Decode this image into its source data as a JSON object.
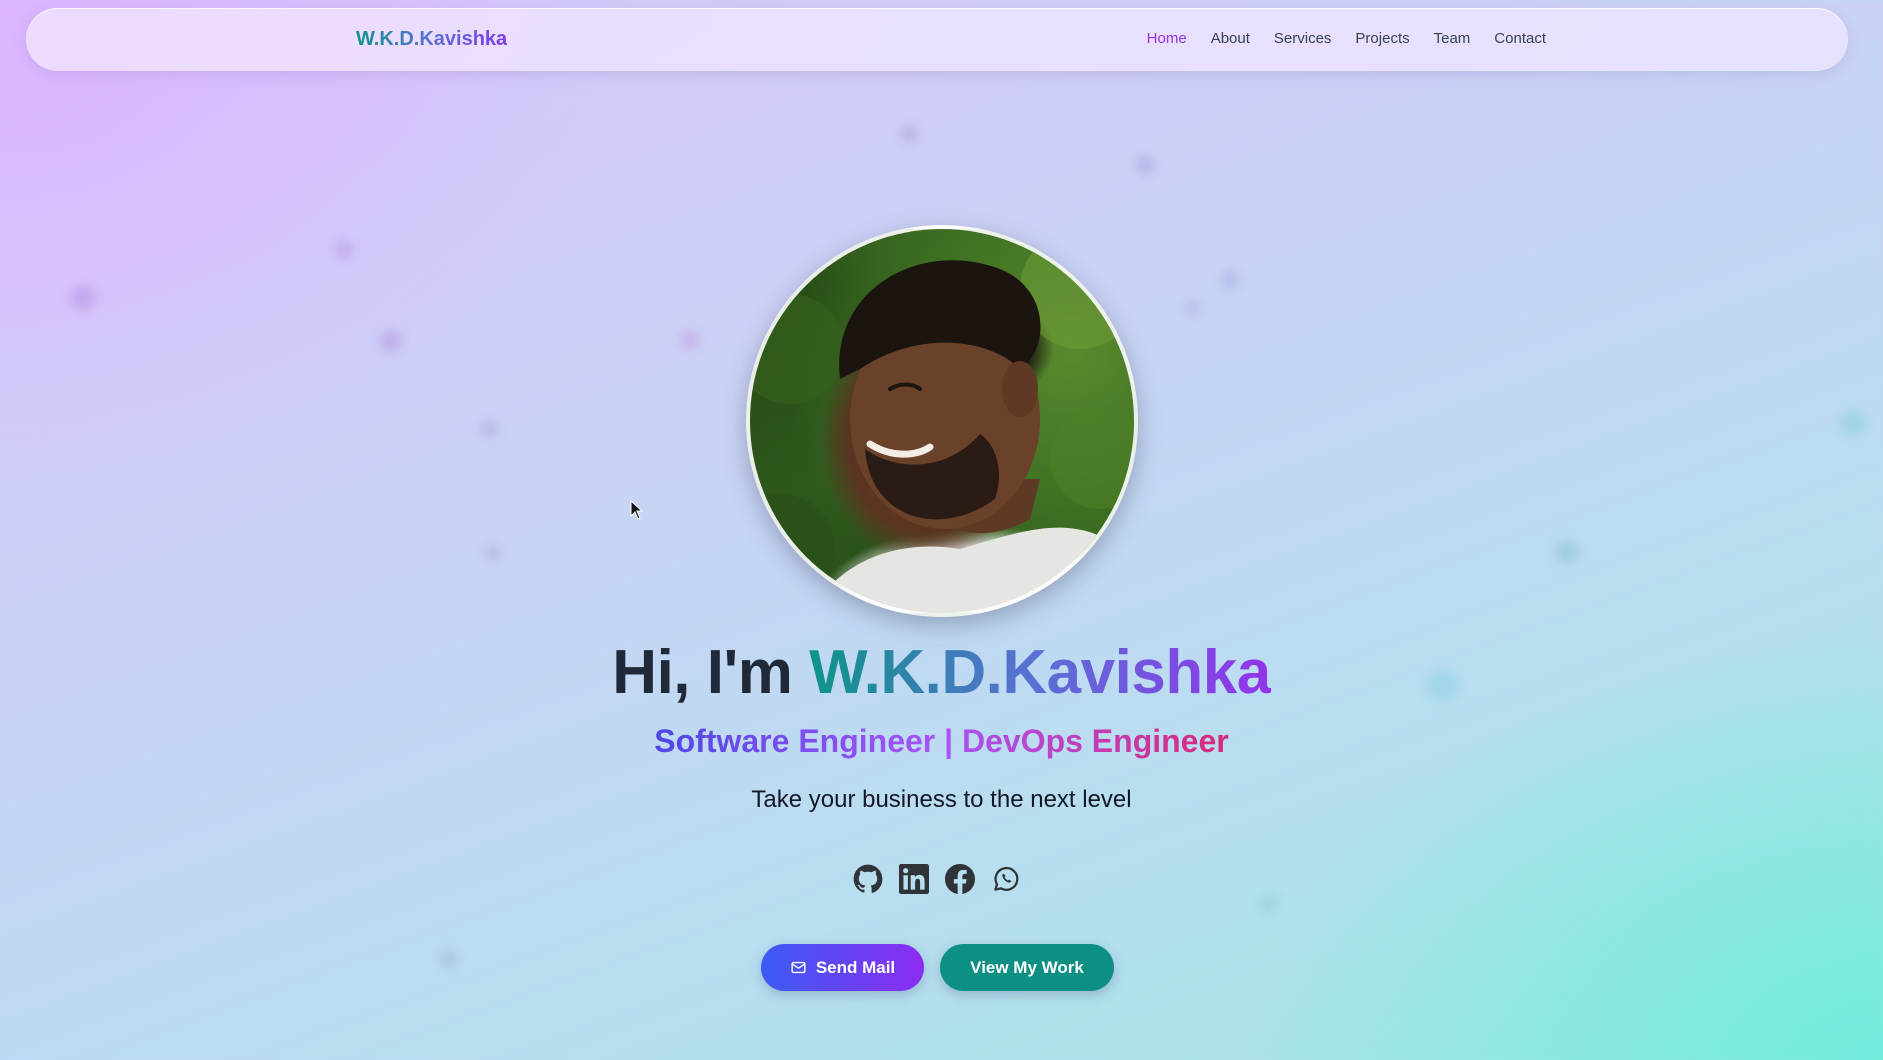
{
  "navbar": {
    "brand": "W.K.D.Kavishka",
    "links": [
      {
        "label": "Home",
        "active": true
      },
      {
        "label": "About",
        "active": false
      },
      {
        "label": "Services",
        "active": false
      },
      {
        "label": "Projects",
        "active": false
      },
      {
        "label": "Team",
        "active": false
      },
      {
        "label": "Contact",
        "active": false
      }
    ]
  },
  "hero": {
    "greeting": "Hi, I'm ",
    "name": "W.K.D.Kavishka",
    "role": "Software Engineer | DevOps Engineer",
    "tagline": "Take your business to the next level",
    "avatar_alt": "profile-photo"
  },
  "socials": [
    {
      "icon": "github-icon"
    },
    {
      "icon": "linkedin-icon"
    },
    {
      "icon": "facebook-icon"
    },
    {
      "icon": "whatsapp-icon"
    }
  ],
  "buttons": {
    "send_mail": "Send Mail",
    "view_work": "View My Work"
  },
  "colors": {
    "active_nav": "#9333ea",
    "nav_text": "#374151",
    "heading": "#1f2937",
    "send_mail_gradient_start": "#3b5bf5",
    "send_mail_gradient_end": "#8b2cf0",
    "view_work_bg": "#0e8f83"
  }
}
